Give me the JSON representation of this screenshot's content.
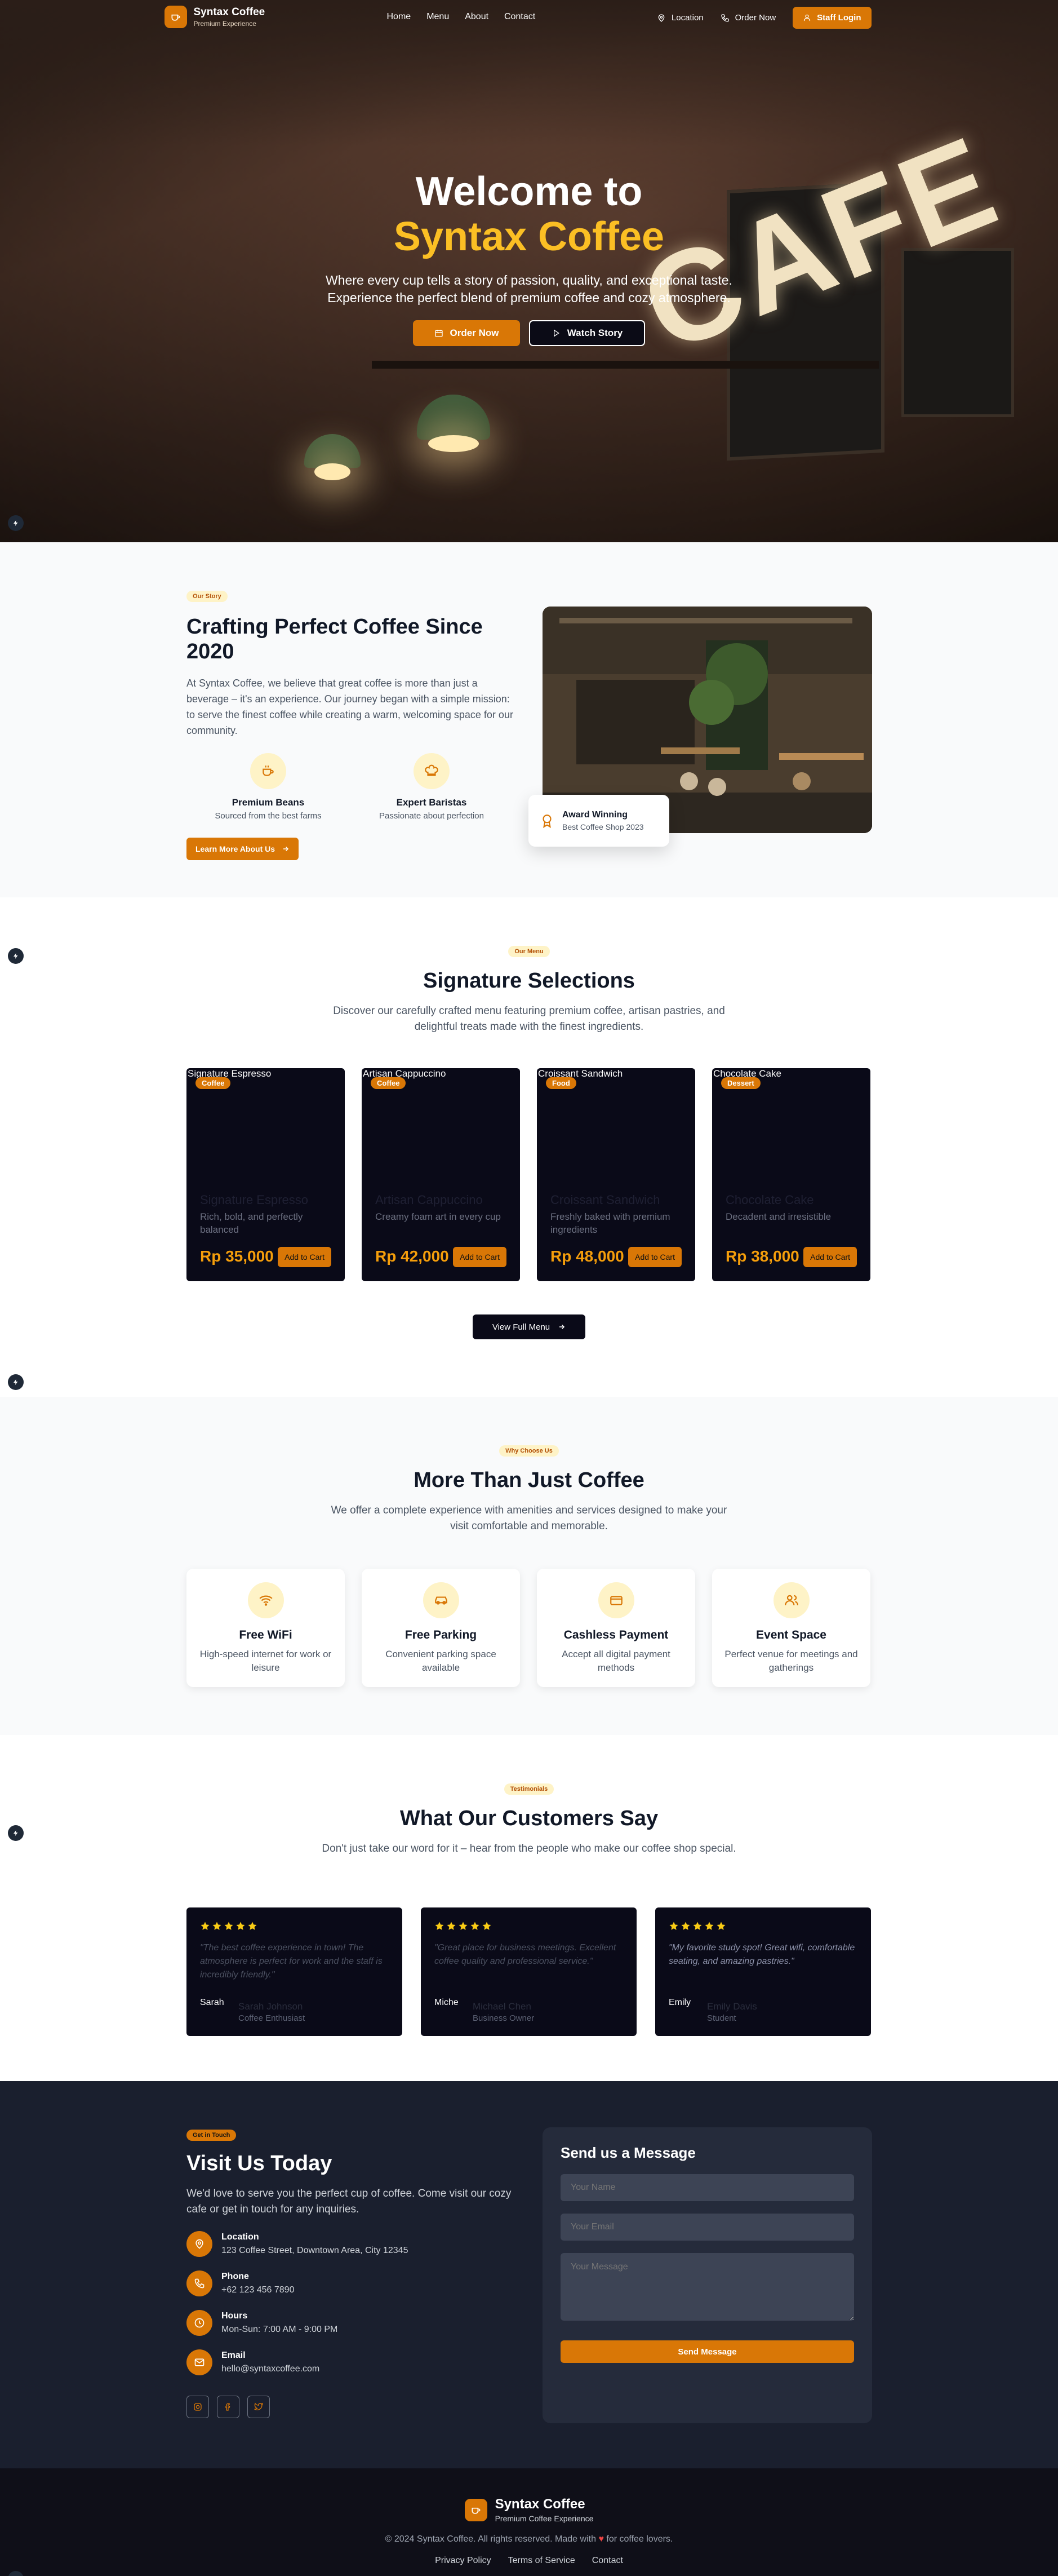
{
  "nav": {
    "brand": "Syntax Coffee",
    "brand_sub": "Premium Experience",
    "links": [
      "Home",
      "Menu",
      "About",
      "Contact"
    ],
    "location": "Location",
    "order": "Order Now",
    "staff": "Staff Login"
  },
  "hero": {
    "title_1": "Welcome to",
    "title_2": "Syntax Coffee",
    "subtitle": "Where every cup tells a story of passion, quality, and exceptional taste. Experience the perfect blend of premium coffee and cozy atmosphere.",
    "order_btn": "Order Now",
    "watch_btn": "Watch Story",
    "sign_text": "CAFE"
  },
  "story": {
    "pill": "Our Story",
    "title": "Crafting Perfect Coffee Since 2020",
    "text": "At Syntax Coffee, we believe that great coffee is more than just a beverage – it's an experience. Our journey began with a simple mission: to serve the finest coffee while creating a warm, welcoming space for our community.",
    "features": [
      {
        "title": "Premium Beans",
        "sub": "Sourced from the best farms"
      },
      {
        "title": "Expert Baristas",
        "sub": "Passionate about perfection"
      }
    ],
    "button": "Learn More About Us",
    "award_title": "Award Winning",
    "award_sub": "Best Coffee Shop 2023"
  },
  "menu": {
    "pill": "Our Menu",
    "title": "Signature Selections",
    "text": "Discover our carefully crafted menu featuring premium coffee, artisan pastries, and delightful treats made with the finest ingredients.",
    "items": [
      {
        "alt": "Signature Espresso",
        "badge": "Coffee",
        "name": "Signature Espresso",
        "desc": "Rich, bold, and perfectly balanced",
        "price": "Rp 35,000",
        "add": "Add to Cart"
      },
      {
        "alt": "Artisan Cappuccino",
        "badge": "Coffee",
        "name": "Artisan Cappuccino",
        "desc": "Creamy foam art in every cup",
        "price": "Rp 42,000",
        "add": "Add to Cart"
      },
      {
        "alt": "Croissant Sandwich",
        "badge": "Food",
        "name": "Croissant Sandwich",
        "desc": "Freshly baked with premium ingredients",
        "price": "Rp 48,000",
        "add": "Add to Cart"
      },
      {
        "alt": "Chocolate Cake",
        "badge": "Dessert",
        "name": "Chocolate Cake",
        "desc": "Decadent and irresistible",
        "price": "Rp 38,000",
        "add": "Add to Cart"
      }
    ],
    "button": "View Full Menu"
  },
  "why": {
    "pill": "Why Choose Us",
    "title": "More Than Just Coffee",
    "text": "We offer a complete experience with amenities and services designed to make your visit comfortable and memorable.",
    "items": [
      {
        "icon": "wifi-icon",
        "title": "Free WiFi",
        "sub": "High-speed internet for work or leisure"
      },
      {
        "icon": "car-icon",
        "title": "Free Parking",
        "sub": "Convenient parking space available"
      },
      {
        "icon": "credit-card-icon",
        "title": "Cashless Payment",
        "sub": "Accept all digital payment methods"
      },
      {
        "icon": "users-icon",
        "title": "Event Space",
        "sub": "Perfect venue for meetings and gatherings"
      }
    ]
  },
  "testimonials": {
    "pill": "Testimonials",
    "title": "What Our Customers Say",
    "text": "Don't just take our word for it – hear from the people who make our coffee shop special.",
    "items": [
      {
        "quote": "\"The best coffee experience in town! The atmosphere is perfect for work and the staff is incredibly friendly.\"",
        "avatar": "Sarah",
        "name": "Sarah Johnson",
        "role": "Coffee Enthusiast"
      },
      {
        "quote": "\"Great place for business meetings. Excellent coffee quality and professional service.\"",
        "avatar": "Miche",
        "name": "Michael Chen",
        "role": "Business Owner"
      },
      {
        "quote": "\"My favorite study spot! Great wifi, comfortable seating, and amazing pastries.\"",
        "avatar": "Emily",
        "name": "Emily Davis",
        "role": "Student"
      }
    ]
  },
  "contact": {
    "pill": "Get in Touch",
    "title": "Visit Us Today",
    "text": "We'd love to serve you the perfect cup of coffee. Come visit our cozy cafe or get in touch for any inquiries.",
    "items": [
      {
        "icon": "map-pin-icon",
        "title": "Location",
        "sub": "123 Coffee Street, Downtown Area, City 12345"
      },
      {
        "icon": "phone-icon",
        "title": "Phone",
        "sub": "+62 123 456 7890"
      },
      {
        "icon": "clock-icon",
        "title": "Hours",
        "sub": "Mon-Sun: 7:00 AM - 9:00 PM"
      },
      {
        "icon": "mail-icon",
        "title": "Email",
        "sub": "hello@syntaxcoffee.com"
      }
    ],
    "form_title": "Send us a Message",
    "name_ph": "Your Name",
    "email_ph": "Your Email",
    "msg_ph": "Your Message",
    "send": "Send Message"
  },
  "footer": {
    "brand": "Syntax Coffee",
    "sub": "Premium Coffee Experience",
    "copy_pre": "© 2024 Syntax Coffee. All rights reserved. Made with",
    "heart": "♥",
    "copy_post": "for coffee lovers.",
    "links": [
      "Privacy Policy",
      "Terms of Service",
      "Contact"
    ]
  },
  "colors": {
    "accent": "#d97706",
    "gold": "#fbbf24",
    "dark": "#0a0a18",
    "contact_bg": "#1a1f2e"
  }
}
